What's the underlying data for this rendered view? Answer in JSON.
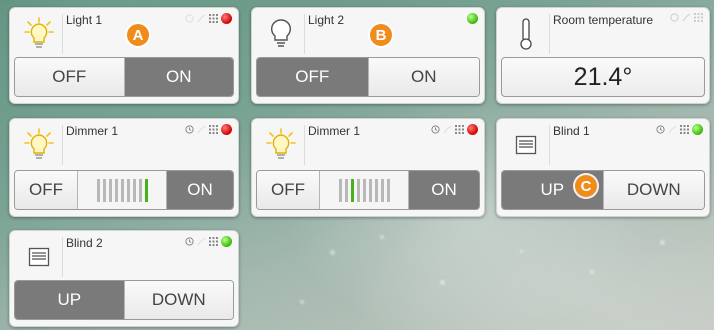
{
  "colors": {
    "led_on": "#47c414",
    "led_off": "#d80d0d",
    "active_button": "#7a7a7a",
    "marker": "#f08c1c",
    "slider_on": "#46b319"
  },
  "cards": {
    "light1": {
      "title": "Light 1",
      "icon": "bulb-lit-icon",
      "status": "red",
      "off": "OFF",
      "on": "ON",
      "active": "on"
    },
    "light2": {
      "title": "Light 2",
      "icon": "bulb-off-icon",
      "status": "green",
      "off": "OFF",
      "on": "ON",
      "active": "off"
    },
    "temp": {
      "title": "Room temperature",
      "icon": "thermometer-icon",
      "value": "21.4°"
    },
    "dimmer1": {
      "title": "Dimmer 1",
      "icon": "bulb-lit-icon",
      "status": "red",
      "off": "OFF",
      "on": "ON",
      "active": "on",
      "level_ticks": 9,
      "level_index": 8
    },
    "dimmer2": {
      "title": "Dimmer 1",
      "icon": "bulb-lit-icon",
      "status": "red",
      "off": "OFF",
      "on": "ON",
      "active": "none",
      "level_ticks": 9,
      "level_index": 2
    },
    "blind1": {
      "title": "Blind 1",
      "icon": "blind-icon",
      "status": "green",
      "up": "UP",
      "down": "DOWN",
      "active": "up"
    },
    "blind2": {
      "title": "Blind 2",
      "icon": "blind-icon",
      "status": "green",
      "up": "UP",
      "down": "DOWN",
      "active": "up"
    }
  },
  "markers": {
    "a": "A",
    "b": "B",
    "c": "C"
  }
}
